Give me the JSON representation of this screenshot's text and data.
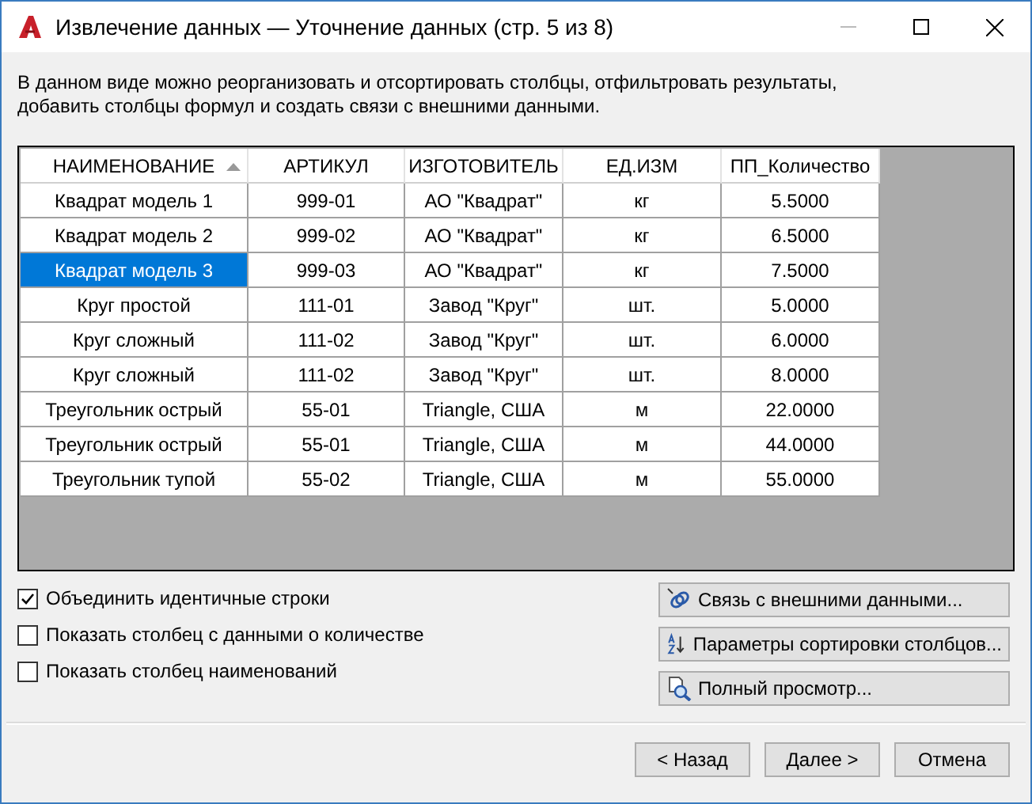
{
  "window": {
    "title": "Извлечение данных — Уточнение данных (стр. 5 из 8)"
  },
  "description": "В данном виде можно реорганизовать и отсортировать столбцы, отфильтровать результаты,\nдобавить столбцы формул и создать связи с внешними данными.",
  "table": {
    "columns": [
      {
        "label": "НАИМЕНОВАНИЕ",
        "sorted": true
      },
      {
        "label": "АРТИКУЛ",
        "sorted": false
      },
      {
        "label": "ИЗГОТОВИТЕЛЬ",
        "sorted": false
      },
      {
        "label": "ЕД.ИЗМ",
        "sorted": false
      },
      {
        "label": "ПП_Количество",
        "sorted": false
      }
    ],
    "rows": [
      {
        "selected": false,
        "cells": [
          "Квадрат модель 1",
          "999-01",
          "АО \"Квадрат\"",
          "кг",
          "5.5000"
        ]
      },
      {
        "selected": false,
        "cells": [
          "Квадрат модель 2",
          "999-02",
          "АО \"Квадрат\"",
          "кг",
          "6.5000"
        ]
      },
      {
        "selected": true,
        "cells": [
          "Квадрат модель 3",
          "999-03",
          "АО \"Квадрат\"",
          "кг",
          "7.5000"
        ]
      },
      {
        "selected": false,
        "cells": [
          "Круг простой",
          "111-01",
          "Завод \"Круг\"",
          "шт.",
          "5.0000"
        ]
      },
      {
        "selected": false,
        "cells": [
          "Круг сложный",
          "111-02",
          "Завод \"Круг\"",
          "шт.",
          "6.0000"
        ]
      },
      {
        "selected": false,
        "cells": [
          "Круг сложный",
          "111-02",
          "Завод \"Круг\"",
          "шт.",
          "8.0000"
        ]
      },
      {
        "selected": false,
        "cells": [
          "Треугольник острый",
          "55-01",
          "Triangle, США",
          "м",
          "22.0000"
        ]
      },
      {
        "selected": false,
        "cells": [
          "Треугольник острый",
          "55-01",
          "Triangle, США",
          "м",
          "44.0000"
        ]
      },
      {
        "selected": false,
        "cells": [
          "Треугольник тупой",
          "55-02",
          "Triangle, США",
          "м",
          "55.0000"
        ]
      }
    ]
  },
  "options": [
    {
      "label": "Объединить идентичные строки",
      "checked": true
    },
    {
      "label": "Показать столбец с данными о количестве",
      "checked": false
    },
    {
      "label": "Показать столбец наименований",
      "checked": false
    }
  ],
  "actions": [
    {
      "label": "Связь с внешними данными...",
      "kind": "link"
    },
    {
      "label": "Параметры сортировки столбцов...",
      "kind": "sort"
    },
    {
      "label": "Полный просмотр...",
      "kind": "preview"
    }
  ],
  "buttons": [
    "< Назад",
    "Далее >",
    "Отмена"
  ]
}
